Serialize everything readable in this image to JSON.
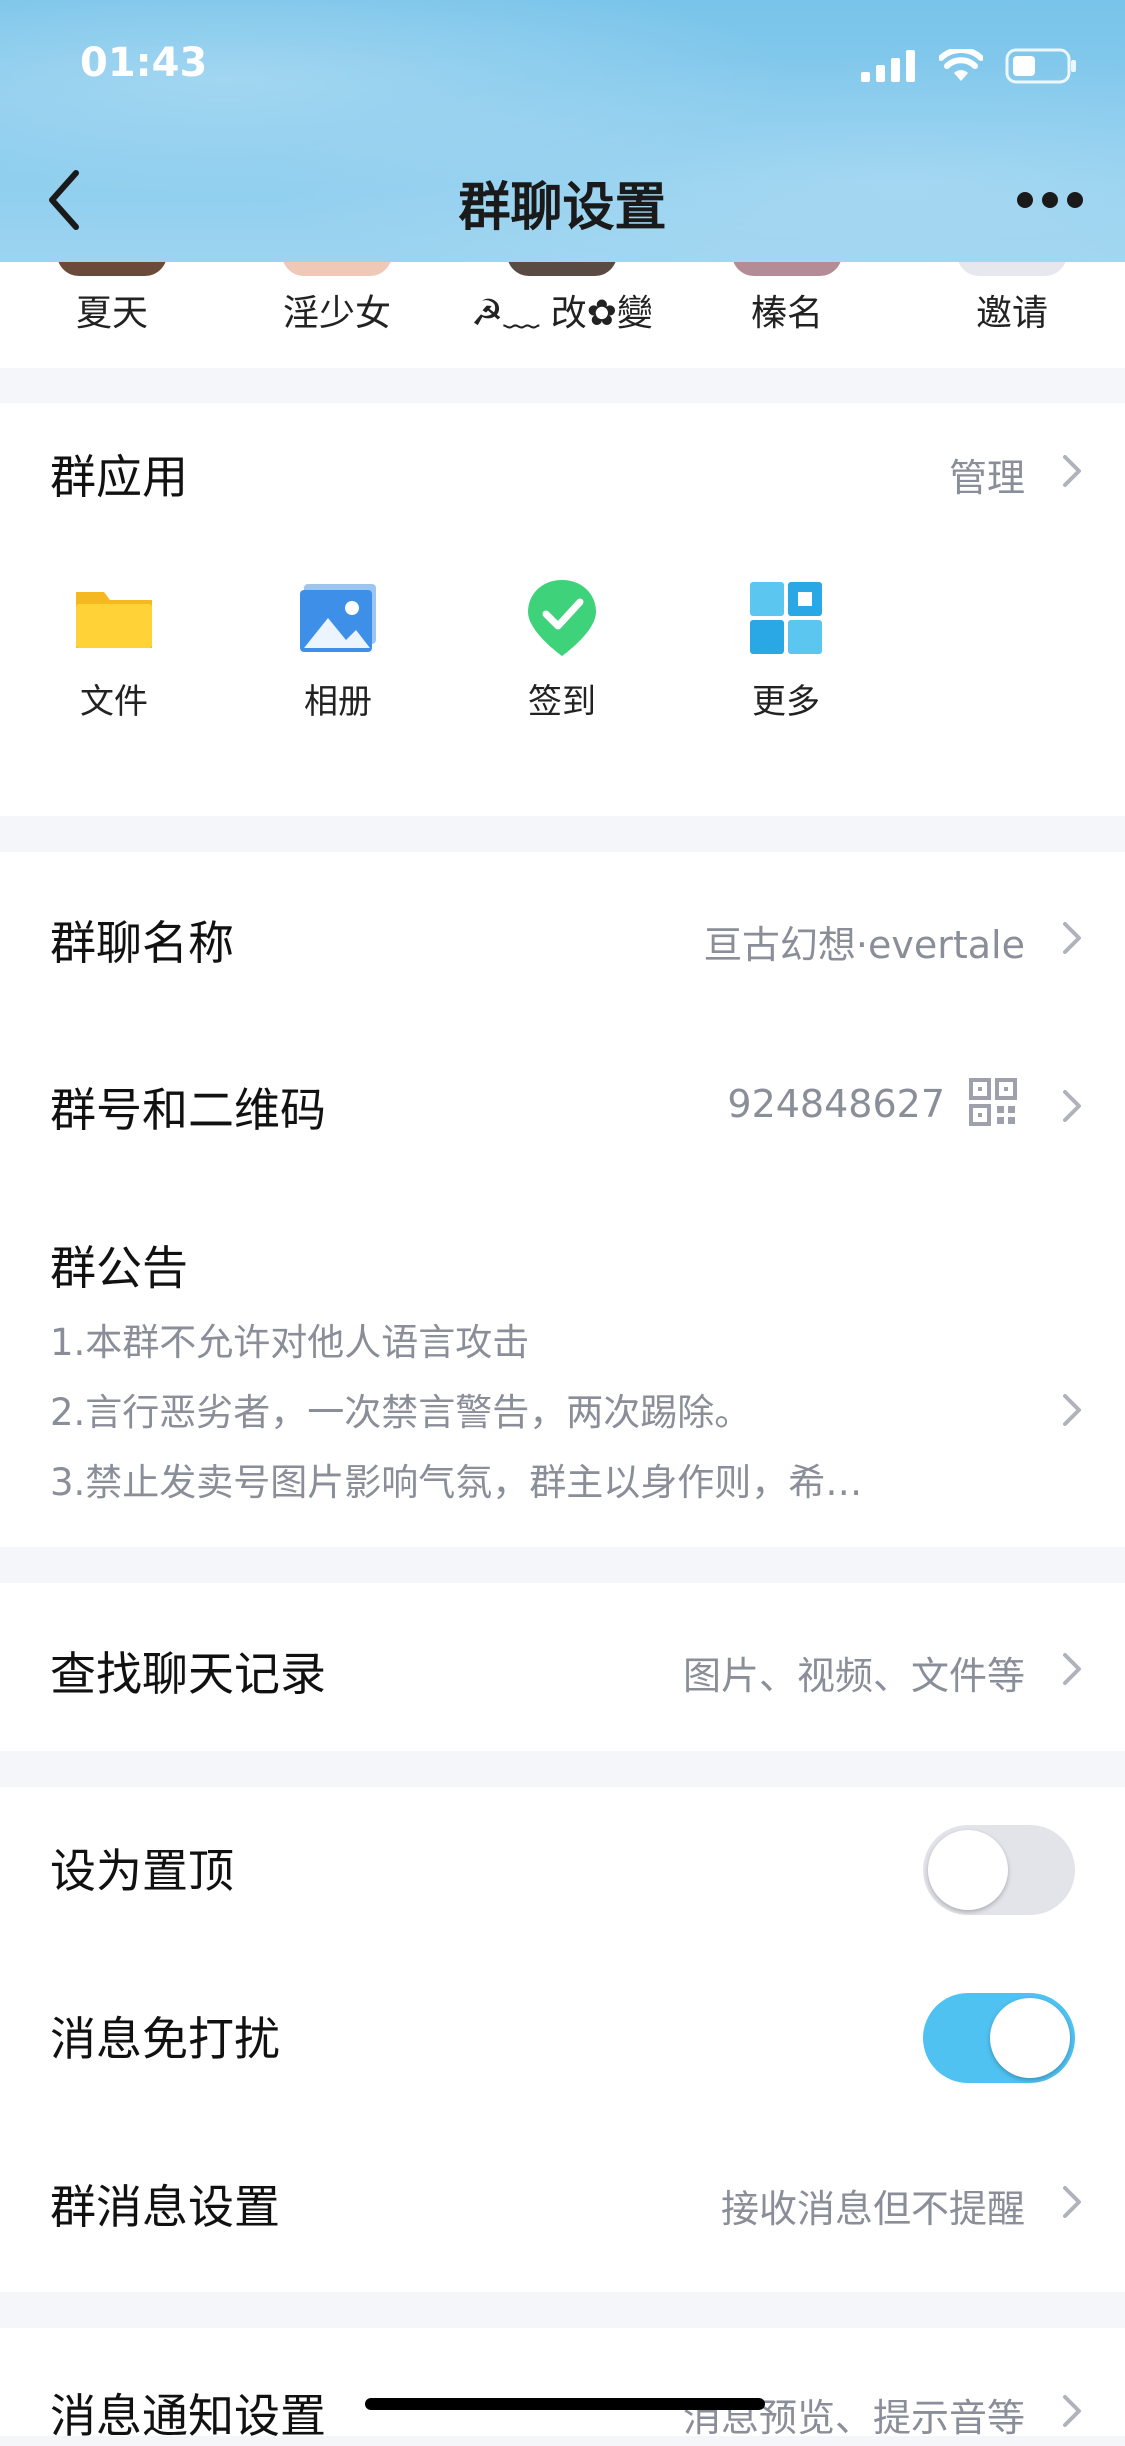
{
  "status_bar": {
    "time": "01:43"
  },
  "nav": {
    "title": "群聊设置"
  },
  "members": [
    {
      "name": "夏天",
      "avatar_color": "#6b4a3a"
    },
    {
      "name": "淫少女",
      "avatar_color": "#f0c8b8"
    },
    {
      "name": "☭﹏ 改✿變",
      "avatar_color": "#5a4a44"
    },
    {
      "name": "榛名",
      "avatar_color": "#b48c96"
    },
    {
      "name": "邀请",
      "avatar_color": "#e6e8ee"
    }
  ],
  "group_apps": {
    "title": "群应用",
    "manage_label": "管理",
    "items": [
      {
        "label": "文件",
        "icon": "folder-icon"
      },
      {
        "label": "相册",
        "icon": "photo-album-icon"
      },
      {
        "label": "签到",
        "icon": "check-in-icon"
      },
      {
        "label": "更多",
        "icon": "grid-icon"
      }
    ]
  },
  "group_info": {
    "name_label": "群聊名称",
    "name_value": "亘古幻想·evertale",
    "id_label": "群号和二维码",
    "id_value": "924848627",
    "notice_label": "群公告",
    "notice_lines": [
      "1.本群不允许对他人语言攻击",
      "2.言行恶劣者，一次禁言警告，两次踢除。",
      "3.禁止发卖号图片影响气氛，群主以身作则，希…"
    ]
  },
  "search_history": {
    "label": "查找聊天记录",
    "value": "图片、视频、文件等"
  },
  "settings": {
    "pin_label": "设为置顶",
    "pin_on": false,
    "mute_label": "消息免打扰",
    "mute_on": true,
    "message_setting_label": "群消息设置",
    "message_setting_value": "接收消息但不提醒"
  },
  "notification": {
    "label": "消息通知设置",
    "value": "消息预览、提示音等"
  },
  "colors": {
    "accent": "#4fc2f2",
    "header_bg": "#86caed",
    "secondary_text": "#8a8e99"
  }
}
